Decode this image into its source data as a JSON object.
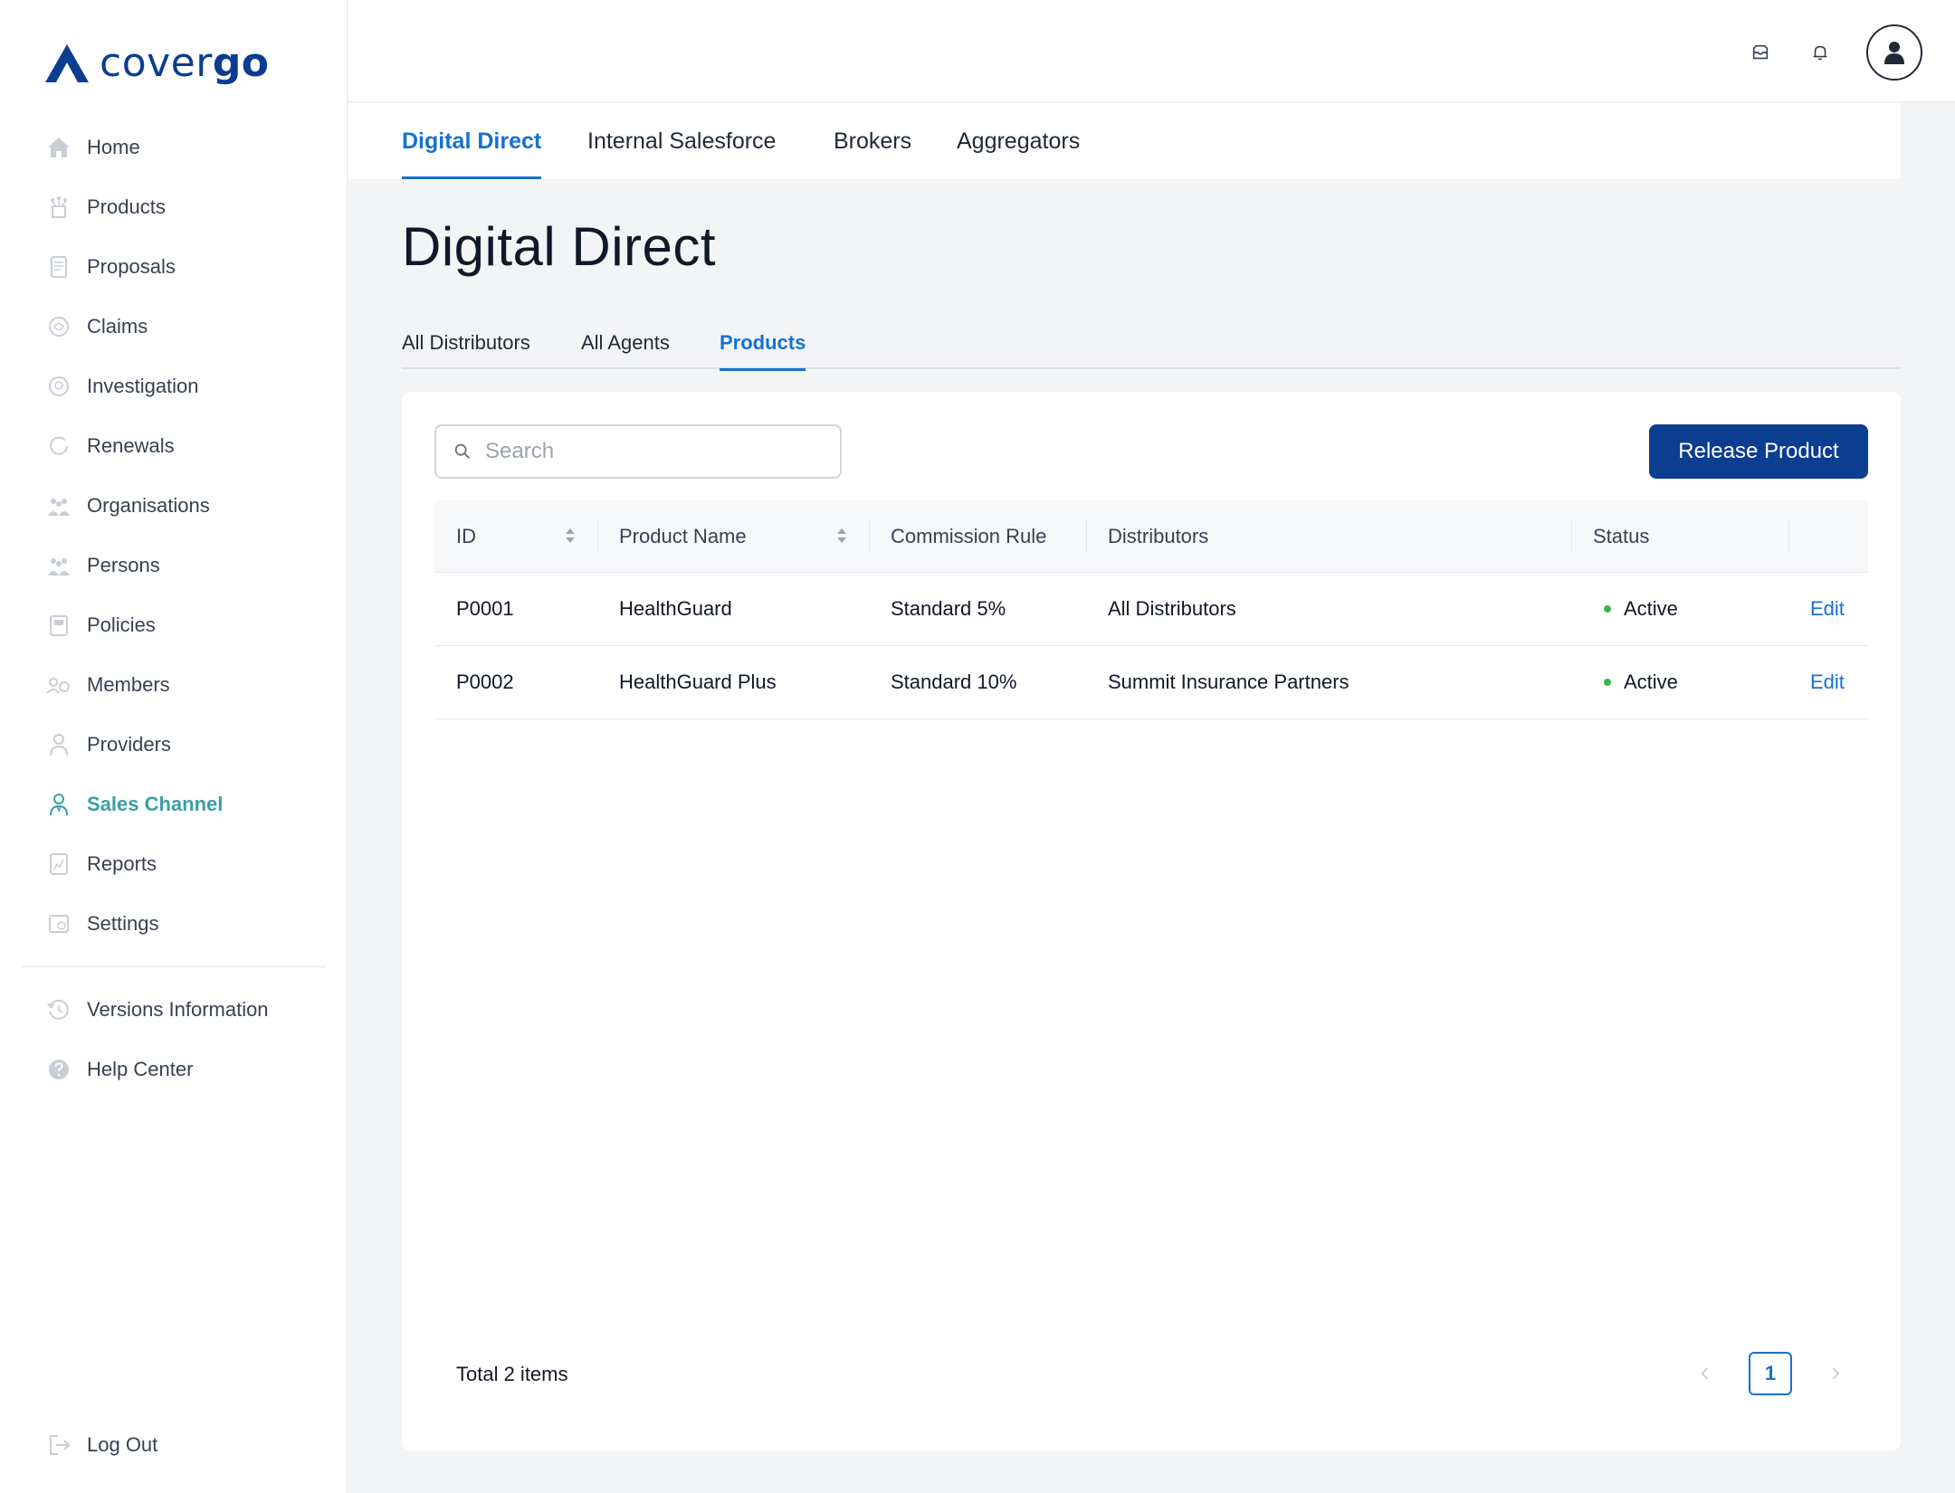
{
  "app": {
    "logo_text_regular": "cover",
    "logo_text_bold": "go",
    "brand_color": "#0b3d91",
    "accent_color": "#1670d1",
    "active_nav_color": "#3a9ea5"
  },
  "sidebar": {
    "items": [
      {
        "label": "Home",
        "icon": "home-icon"
      },
      {
        "label": "Products",
        "icon": "products-icon"
      },
      {
        "label": "Proposals",
        "icon": "proposals-icon"
      },
      {
        "label": "Claims",
        "icon": "claims-icon"
      },
      {
        "label": "Investigation",
        "icon": "investigation-icon"
      },
      {
        "label": "Renewals",
        "icon": "renewals-icon"
      },
      {
        "label": "Organisations",
        "icon": "organisations-icon"
      },
      {
        "label": "Persons",
        "icon": "persons-icon"
      },
      {
        "label": "Policies",
        "icon": "policies-icon"
      },
      {
        "label": "Members",
        "icon": "members-icon"
      },
      {
        "label": "Providers",
        "icon": "providers-icon"
      },
      {
        "label": "Sales Channel",
        "icon": "sales-channel-icon",
        "active": true
      },
      {
        "label": "Reports",
        "icon": "reports-icon"
      },
      {
        "label": "Settings",
        "icon": "settings-icon"
      }
    ],
    "secondary": [
      {
        "label": "Versions Information",
        "icon": "history-icon"
      },
      {
        "label": "Help Center",
        "icon": "help-icon"
      }
    ],
    "logout": {
      "label": "Log Out",
      "icon": "logout-icon"
    }
  },
  "header": {
    "icons": [
      "inbox-icon",
      "bell-icon",
      "user-avatar"
    ]
  },
  "channel_tabs": [
    {
      "label": "Digital Direct",
      "active": true
    },
    {
      "label": "Internal Salesforce"
    },
    {
      "label": "Brokers"
    },
    {
      "label": "Aggregators"
    }
  ],
  "page": {
    "title": "Digital Direct"
  },
  "sub_tabs": [
    {
      "label": "All Distributors"
    },
    {
      "label": "All Agents"
    },
    {
      "label": "Products",
      "active": true
    }
  ],
  "toolbar": {
    "search_placeholder": "Search",
    "search_value": "",
    "release_button": "Release Product"
  },
  "table": {
    "columns": [
      "ID",
      "Product Name",
      "Commission Rule",
      "Distributors",
      "Status"
    ],
    "rows": [
      {
        "id": "P0001",
        "product_name": "HealthGuard",
        "commission_rule": "Standard 5%",
        "distributors": "All Distributors",
        "status": "Active",
        "action": "Edit"
      },
      {
        "id": "P0002",
        "product_name": "HealthGuard Plus",
        "commission_rule": "Standard 10%",
        "distributors": "Summit Insurance Partners",
        "status": "Active",
        "action": "Edit"
      }
    ]
  },
  "pagination": {
    "total_text": "Total 2 items",
    "current_page": "1"
  }
}
